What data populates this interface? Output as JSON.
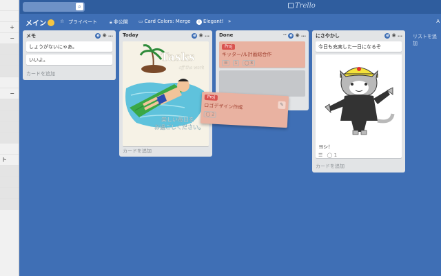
{
  "sidebar": {
    "rows": [
      {
        "text": "",
        "shaded": false
      },
      {
        "text": "",
        "shaded": false
      },
      {
        "text": "+",
        "shaded": false
      },
      {
        "text": "−",
        "shaded": false
      },
      {
        "text": "",
        "shaded": true
      },
      {
        "text": "",
        "shaded": true
      },
      {
        "text": "",
        "shaded": true
      },
      {
        "text": "",
        "shaded": false
      },
      {
        "text": "−",
        "shaded": false
      },
      {
        "text": "",
        "shaded": true
      },
      {
        "text": "",
        "shaded": true
      },
      {
        "text": "",
        "shaded": true
      },
      {
        "text": "",
        "shaded": true
      },
      {
        "text": "",
        "shaded": false
      },
      {
        "text": "ト",
        "shaded": false
      },
      {
        "text": "",
        "shaded": true
      },
      {
        "text": "",
        "shaded": true
      },
      {
        "text": "",
        "shaded": true
      },
      {
        "text": "",
        "shaded": true
      }
    ]
  },
  "topbar": {
    "logo_text": "Trello"
  },
  "boardbar": {
    "title": "メイン",
    "star": "☆",
    "private_label": "プライベート",
    "private_icon": "👥",
    "public_label": "非公開",
    "public_icon": "🔒",
    "card_colors_label": "Card Colors: Merge",
    "card_colors_icon": "▭",
    "elegant_label": "Elegant!",
    "elegant_icon": "i",
    "more": "»",
    "right_cut": "A"
  },
  "lists": [
    {
      "title": "メモ",
      "cards": [
        "しょうがないにゃあ。",
        "いいよ。"
      ],
      "add_card": "カードを追加"
    },
    {
      "title": "Today",
      "cover_title": "Tasks",
      "cover_sub": "off the work",
      "cover_caption_1": "楽しい毎日を",
      "cover_caption_2": "お過ごしください。",
      "add_card": "カードを追加"
    },
    {
      "title": "Done",
      "card_label": "Proj",
      "card_text": "キッター/ル計画総合作",
      "card_badges": [
        "☰",
        "1",
        "◯ 8"
      ],
      "add_card": ""
    },
    {
      "title": "にさやかし",
      "card_text": "今日も充実した一日になるぞ",
      "cat_card_text": "ヨシ！",
      "cat_badges": [
        "☰",
        "◯ 1"
      ],
      "add_card": "カードを追加"
    }
  ],
  "dragged_card": {
    "label": "Proj",
    "text": "ロゴデザイン作成",
    "badge": "◯ 2",
    "edit_icon": "✎"
  },
  "add_list": "リストを追加"
}
